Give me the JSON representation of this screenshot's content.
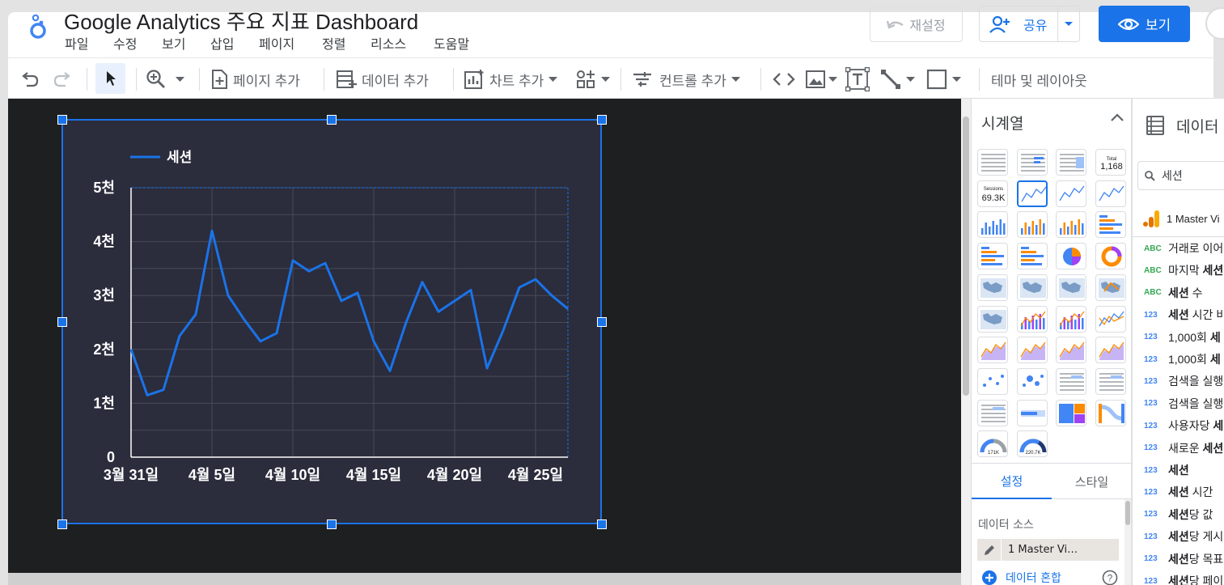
{
  "app": {
    "title": "Google Analytics 주요 지표 Dashboard",
    "menu": [
      "파일",
      "수정",
      "보기",
      "삽입",
      "페이지",
      "정렬",
      "리소스",
      "도움말"
    ],
    "reset_label": "재설정",
    "share_label": "공유",
    "view_label": "보기"
  },
  "toolbar": {
    "add_page": "페이지 추가",
    "add_data": "데이터 추가",
    "add_chart": "차트 추가",
    "add_control": "컨트롤 추가",
    "theme_layout": "테마 및 레이아웃"
  },
  "chart_panel": {
    "title": "시계열",
    "tabs": {
      "setup": "설정",
      "style": "스타일"
    },
    "data_source_label": "데이터 소스",
    "data_source_value": "1 Master Vi…",
    "blend_label": "데이터 혼합",
    "thumb_total_label": "Total",
    "thumb_total_value": "1,168",
    "thumb_sessions_label": "Sessions",
    "thumb_sessions_value": "69.3K",
    "gauge1_value": "171K",
    "gauge2_value": "220.7K"
  },
  "data_panel": {
    "title": "데이터",
    "search_placeholder": "세션",
    "source_name": "1 Master Vi",
    "fields": [
      {
        "type": "ABC",
        "pre": "거래로 이어",
        "bold": ""
      },
      {
        "type": "ABC",
        "pre": "마지막 ",
        "bold": "세션"
      },
      {
        "type": "ABC",
        "pre": "",
        "bold": "세션",
        "post": " 수"
      },
      {
        "type": "123",
        "pre": "",
        "bold": "세션",
        "post": " 시간 비"
      },
      {
        "type": "123",
        "pre": "1,000회 ",
        "bold": "세"
      },
      {
        "type": "123",
        "pre": "1,000회 ",
        "bold": "세"
      },
      {
        "type": "123",
        "pre": "검색을 실행",
        "bold": ""
      },
      {
        "type": "123",
        "pre": "검색을 실행",
        "bold": ""
      },
      {
        "type": "123",
        "pre": "사용자당 ",
        "bold": "세"
      },
      {
        "type": "123",
        "pre": "새로운 ",
        "bold": "세션"
      },
      {
        "type": "123",
        "pre": "",
        "bold": "세션",
        "post": ""
      },
      {
        "type": "123",
        "pre": "",
        "bold": "세션",
        "post": " 시간"
      },
      {
        "type": "123",
        "pre": "",
        "bold": "세션",
        "post": "당 값"
      },
      {
        "type": "123",
        "pre": "",
        "bold": "세션",
        "post": "당 게시"
      },
      {
        "type": "123",
        "pre": "",
        "bold": "세션",
        "post": "당 목표"
      },
      {
        "type": "123",
        "pre": "",
        "bold": "세션",
        "post": "당 페이"
      }
    ]
  },
  "colors": {
    "accent": "#1a73e8",
    "line": "#1a73e8",
    "chart_bg": "#2b2c3c",
    "canvas_bg": "#1e1f20"
  },
  "chart_data": {
    "type": "line",
    "series": [
      {
        "name": "세션",
        "values": [
          2000,
          1150,
          1250,
          2250,
          2650,
          4200,
          3000,
          2550,
          2150,
          2300,
          3650,
          3450,
          3600,
          2900,
          3050,
          2150,
          1600,
          2500,
          3250,
          2700,
          2900,
          3100,
          1650,
          2350,
          3150,
          3300,
          3000,
          2750
        ]
      }
    ],
    "x_start": "3월 31일",
    "x_tick_labels": [
      "3월 31일",
      "4월 5일",
      "4월 10일",
      "4월 15일",
      "4월 20일",
      "4월 25일"
    ],
    "y_tick_labels": [
      "0",
      "1천",
      "2천",
      "3천",
      "4천",
      "5천"
    ],
    "ylim": [
      0,
      5000
    ],
    "legend": "top-left",
    "grid": true
  }
}
